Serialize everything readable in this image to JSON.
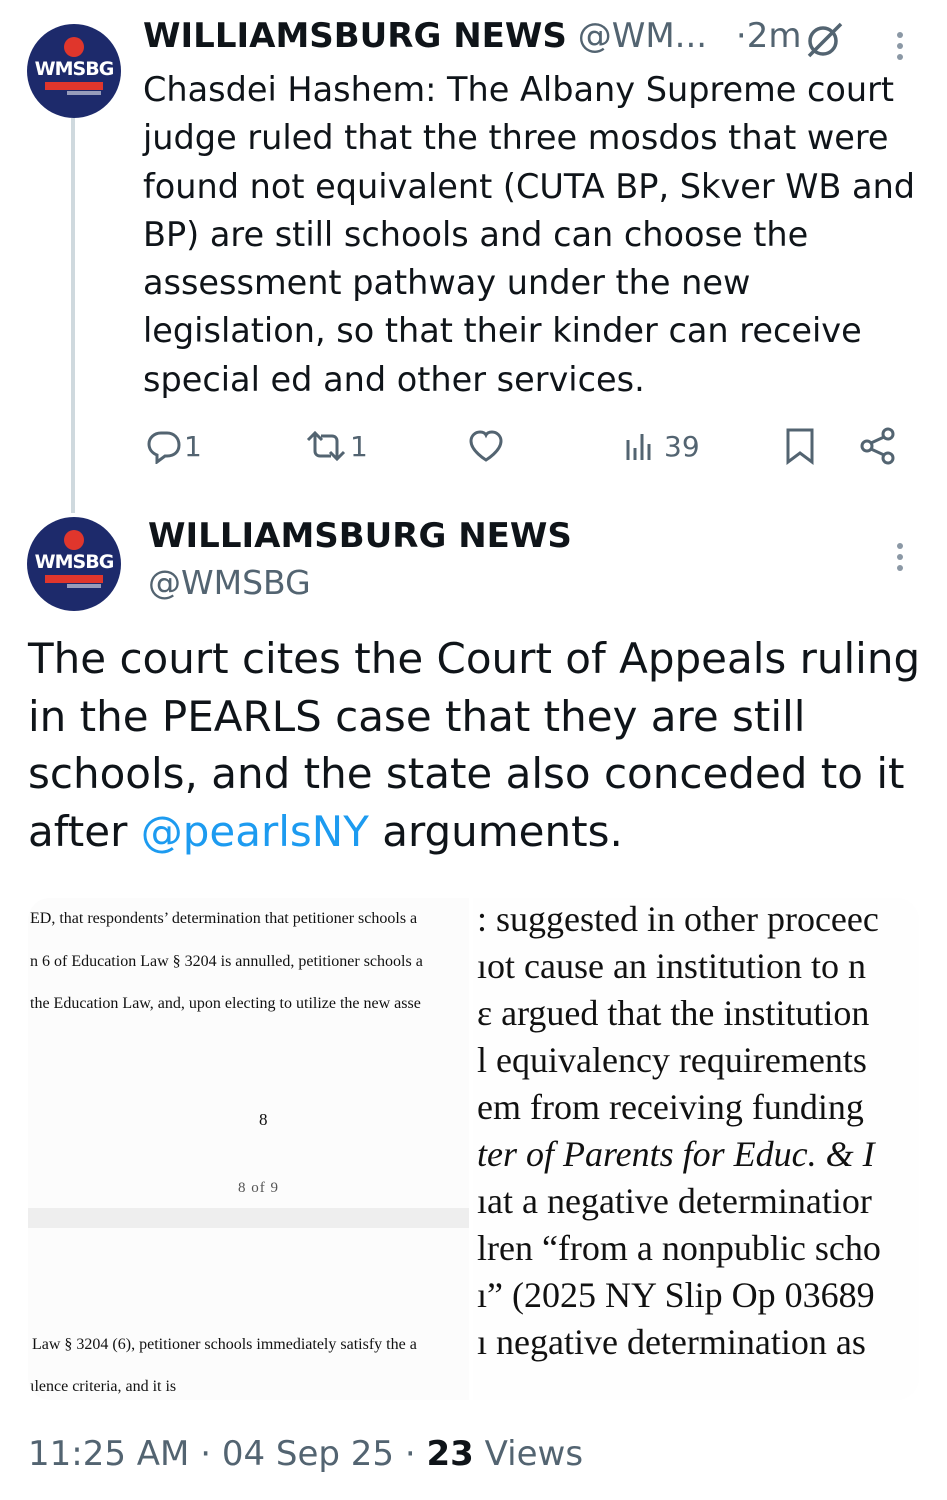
{
  "tweet1": {
    "avatar_label": "WMSBG",
    "display_name": "WILLIAMSBURG NEWS",
    "handle": "@WM...",
    "time": "·2m",
    "text": "Chasdei Hashem: The Albany Supreme court judge ruled that the three mosdos that were found not equivalent (CUTA BP, Skver WB and BP) are still schools and can choose the assessment pathway under the new legislation, so that their kinder can receive special ed and other services.",
    "actions": {
      "replies": "1",
      "reposts": "1",
      "likes": "",
      "views": "39"
    }
  },
  "tweet2": {
    "avatar_label": "WMSBG",
    "display_name": "WILLIAMSBURG NEWS",
    "handle": "@WMSBG",
    "text_before": "The court cites the Court of Appeals ruling in the PEARLS case that they are still schools, and the state also conceded to it after ",
    "mention": "@pearlsNY",
    "text_after": " arguments."
  },
  "media_left": {
    "lines": [
      "ED, that respondents’ determination that petitioner schools a",
      "n 6 of Education Law § 3204 is annulled, petitioner schools a",
      "the Education Law, and, upon electing to utilize the new asse",
      "8",
      "8 of 9",
      "Law § 3204 (6), petitioner schools immediately satisfy the a",
      "ılence criteria, and it is"
    ]
  },
  "media_right": {
    "lines": [
      ": suggested in other proceec",
      "ıot cause an institution to n",
      "ɛ argued that the institution",
      "l equivalency requirements",
      "em from receiving funding",
      "ter of Parents for Educ. & I",
      "ıat a negative determinatior",
      "lren “from a nonpublic scho",
      "ı” (2025 NY Slip Op 03689",
      "ı negative determination as"
    ]
  },
  "footer": {
    "time": "11:25 AM",
    "date": "04 Sep 25",
    "views_count": "23",
    "views_label": "Views"
  },
  "icons": [
    "reply-icon",
    "repost-icon",
    "like-icon",
    "views-icon",
    "bookmark-icon",
    "share-icon",
    "grok-icon",
    "more-icon"
  ]
}
